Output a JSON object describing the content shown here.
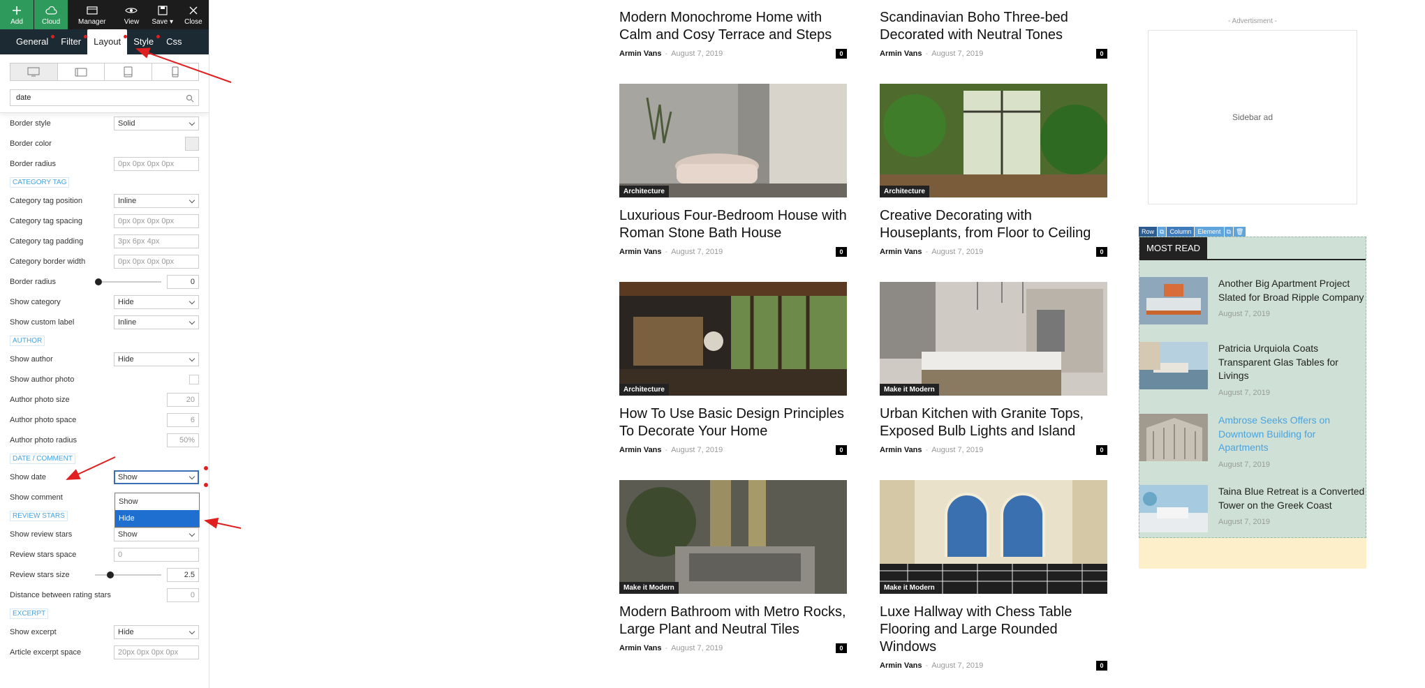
{
  "toolbar": {
    "add": "Add",
    "cloud": "Cloud",
    "manager": "Manager",
    "view": "View",
    "save": "Save",
    "close": "Close"
  },
  "tabs": [
    "General",
    "Filter",
    "Layout",
    "Style",
    "Css"
  ],
  "search": {
    "value": "date"
  },
  "settings": {
    "border_style": {
      "label": "Border style",
      "value": "Solid"
    },
    "border_color": {
      "label": "Border color"
    },
    "border_radius": {
      "label": "Border radius",
      "placeholder": "0px 0px 0px 0px"
    },
    "category_tag_section": "CATEGORY TAG",
    "category_tag_position": {
      "label": "Category tag position",
      "value": "Inline"
    },
    "category_tag_spacing": {
      "label": "Category tag spacing",
      "placeholder": "0px 0px 0px 0px"
    },
    "category_tag_padding": {
      "label": "Category tag padding",
      "placeholder": "3px 6px 4px"
    },
    "category_border_width": {
      "label": "Category border width",
      "placeholder": "0px 0px 0px 0px"
    },
    "cat_border_radius": {
      "label": "Border radius",
      "value": "0",
      "level": 0
    },
    "show_category": {
      "label": "Show category",
      "value": "Hide"
    },
    "show_custom_label": {
      "label": "Show custom label",
      "value": "Inline"
    },
    "author_section": "AUTHOR",
    "show_author": {
      "label": "Show author",
      "value": "Hide"
    },
    "show_author_photo": {
      "label": "Show author photo"
    },
    "author_photo_size": {
      "label": "Author photo size",
      "value": "20"
    },
    "author_photo_space": {
      "label": "Author photo space",
      "value": "6"
    },
    "author_photo_radius": {
      "label": "Author photo radius",
      "value": "50%"
    },
    "date_section": "DATE / COMMENT",
    "show_date": {
      "label": "Show date",
      "value": "Show",
      "options": [
        "Show",
        "Hide"
      ],
      "highlighted": "Hide"
    },
    "show_comment": {
      "label": "Show comment"
    },
    "review_section": "REVIEW STARS",
    "show_review_stars": {
      "label": "Show review stars",
      "value": "Show"
    },
    "review_stars_space": {
      "label": "Review stars space",
      "placeholder": "0"
    },
    "review_stars_size": {
      "label": "Review stars size",
      "value": "2.5",
      "level": 0.2
    },
    "distance_rating_stars": {
      "label": "Distance between rating stars",
      "value": "0"
    },
    "excerpt_section": "EXCERPT",
    "show_excerpt": {
      "label": "Show excerpt",
      "value": "Hide"
    },
    "article_excerpt_space": {
      "label": "Article excerpt space",
      "placeholder": "20px 0px 0px 0px"
    }
  },
  "articles": [
    {
      "title": "Modern Monochrome Home with Calm and Cosy Terrace and Steps",
      "author": "Armin Vans",
      "date": "August 7, 2019",
      "comments": "0"
    },
    {
      "title": "Scandinavian Boho Three-bed Decorated with Neutral Tones",
      "author": "Armin Vans",
      "date": "August 7, 2019",
      "comments": "0"
    },
    {
      "title": "Luxurious Four-Bedroom House with Roman Stone Bath House",
      "category": "Architecture",
      "author": "Armin Vans",
      "date": "August 7, 2019",
      "comments": "0"
    },
    {
      "title": "Creative Decorating with Houseplants, from Floor to Ceiling",
      "category": "Architecture",
      "author": "Armin Vans",
      "date": "August 7, 2019",
      "comments": "0"
    },
    {
      "title": "How To Use Basic Design Principles To Decorate Your Home",
      "category": "Architecture",
      "author": "Armin Vans",
      "date": "August 7, 2019",
      "comments": "0"
    },
    {
      "title": "Urban Kitchen with Granite Tops, Exposed Bulb Lights and Island",
      "category": "Make it Modern",
      "author": "Armin Vans",
      "date": "August 7, 2019",
      "comments": "0"
    },
    {
      "title": "Modern Bathroom with Metro Rocks, Large Plant and Neutral Tiles",
      "category": "Make it Modern",
      "author": "Armin Vans",
      "date": "August 7, 2019",
      "comments": "0"
    },
    {
      "title": "Luxe Hallway with Chess Table Flooring and Large Rounded Windows",
      "category": "Make it Modern",
      "author": "Armin Vans",
      "date": "August 7, 2019",
      "comments": "0"
    }
  ],
  "sidebar": {
    "ad_label": "- Advertisment -",
    "ad_text": "Sidebar ad",
    "builder_bar": {
      "row": "Row",
      "column": "Column",
      "element": "Element"
    },
    "most_read_title": "MOST READ",
    "most_read": [
      {
        "title": "Another Big Apartment Project Slated for Broad Ripple Company",
        "date": "August 7, 2019"
      },
      {
        "title": "Patricia Urquiola Coats Transparent Glas Tables for Livings",
        "date": "August 7, 2019"
      },
      {
        "title": "Ambrose Seeks Offers on Downtown Building for Apartments",
        "date": "August 7, 2019"
      },
      {
        "title": "Taina Blue Retreat is a Converted Tower on the Greek Coast",
        "date": "August 7, 2019"
      }
    ]
  },
  "colors": {
    "accent_green": "#2e9a5b",
    "tab_bar": "#1c2a33",
    "section_blue": "#4aa3df",
    "most_read_bg": "#cfe1d6",
    "annotation_red": "#e02020"
  }
}
